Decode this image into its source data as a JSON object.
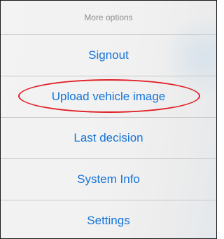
{
  "header": {
    "title": "More options"
  },
  "menu": {
    "items": [
      {
        "label": "Signout"
      },
      {
        "label": "Upload vehicle image"
      },
      {
        "label": "Last decision"
      },
      {
        "label": "System Info"
      },
      {
        "label": "Settings"
      }
    ]
  },
  "colors": {
    "accent": "#1474d8",
    "highlight": "#e01e24",
    "header_text": "#8e8e93",
    "separator": "#c8c8cc"
  }
}
